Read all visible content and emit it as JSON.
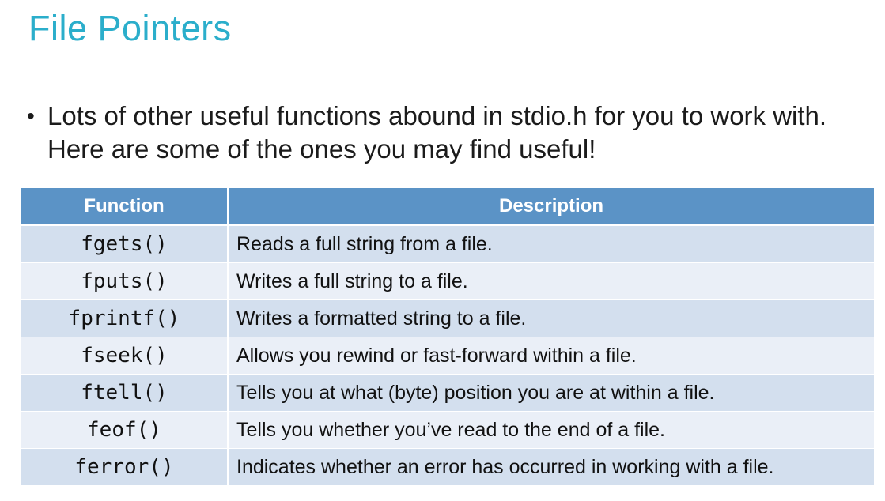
{
  "slide": {
    "title": "File Pointers",
    "bullet": "Lots of other useful functions abound in stdio.h for you to work with. Here are some of the ones you may find useful!"
  },
  "table": {
    "headers": [
      "Function",
      "Description"
    ],
    "rows": [
      {
        "function": "fgets()",
        "description": "Reads a full string from a file."
      },
      {
        "function": "fputs()",
        "description": "Writes a full string to a file."
      },
      {
        "function": "fprintf()",
        "description": "Writes a formatted string to a file."
      },
      {
        "function": "fseek()",
        "description": "Allows you rewind or fast-forward within a file."
      },
      {
        "function": "ftell()",
        "description": "Tells you at what (byte) position you are at within a file."
      },
      {
        "function": "feof()",
        "description": "Tells you whether you’ve read to the end of a file."
      },
      {
        "function": "ferror()",
        "description": "Indicates whether an error has occurred in working with a file."
      }
    ]
  },
  "colors": {
    "title": "#2BAECB",
    "header_bg": "#5B93C6",
    "row_band_dark": "#D3DFEE",
    "row_band_light": "#EAEFF7"
  }
}
